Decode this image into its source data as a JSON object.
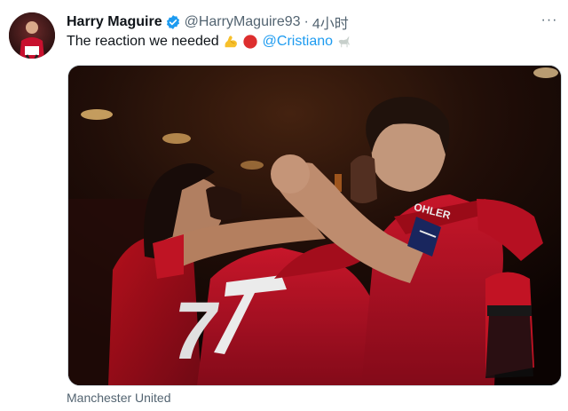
{
  "tweet": {
    "author_name": "Harry Maguire",
    "author_handle": "@HarryMaguire93",
    "separator": "·",
    "time": "4小时",
    "more_label": "···",
    "text": "The reaction we needed",
    "mention": "@Cristiano",
    "emoji": [
      "flexed-biceps",
      "red-circle",
      "goat"
    ],
    "media_caption": "Manchester United",
    "jersey_number": "7",
    "sleeve_sponsor": "OHLER"
  },
  "colors": {
    "link": "#1d9bf0",
    "verified": "#1d9bf0",
    "secondary_text": "#536471",
    "kit_red": "#c8102e"
  }
}
